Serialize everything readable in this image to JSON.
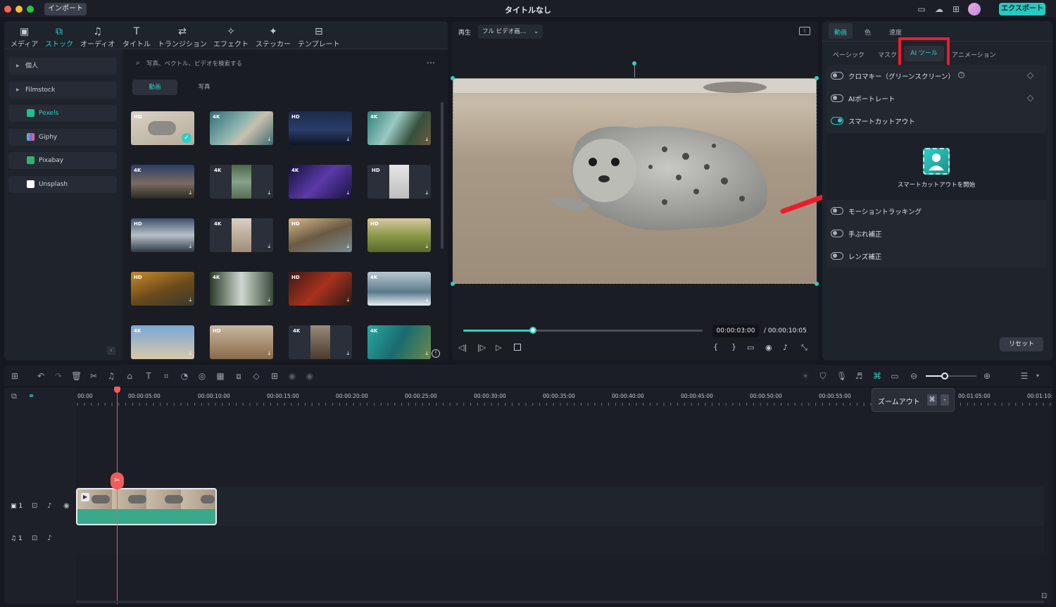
{
  "titlebar": {
    "import_label": "インポート",
    "window_title": "タイトルなし",
    "export_label": "エクスポート"
  },
  "media_toolbar": [
    {
      "label": "メディア",
      "icon": "media-icon"
    },
    {
      "label": "ストック",
      "icon": "stock-icon",
      "active": true
    },
    {
      "label": "オーディオ",
      "icon": "audio-icon"
    },
    {
      "label": "タイトル",
      "icon": "title-icon"
    },
    {
      "label": "トランジション",
      "icon": "transition-icon"
    },
    {
      "label": "エフェクト",
      "icon": "effect-icon"
    },
    {
      "label": "ステッカー",
      "icon": "sticker-icon"
    },
    {
      "label": "テンプレート",
      "icon": "template-icon"
    }
  ],
  "sidebar": {
    "items": [
      {
        "label": "個人"
      },
      {
        "label": "Filmstock"
      },
      {
        "label": "Pexels",
        "color": "#1fbf8f",
        "active": true
      },
      {
        "label": "Giphy",
        "color": "#8a5cf6"
      },
      {
        "label": "Pixabay",
        "color": "#2bb673"
      },
      {
        "label": "Unsplash",
        "color": "#ffffff"
      }
    ]
  },
  "stock": {
    "search_placeholder": "写真、ベクトル、ビデオを検索する",
    "tab_video": "動画",
    "tab_photo": "写真",
    "badges": [
      "HD",
      "4K",
      "HD",
      "4K",
      "4K",
      "4K",
      "4K",
      "HD",
      "HD",
      "4K",
      "HD",
      "HD",
      "HD",
      "4K",
      "HD",
      "4K",
      "4K",
      "HD",
      "4K",
      "4K"
    ]
  },
  "preview": {
    "play_label": "再生",
    "quality": "フル ビデオ画…",
    "current_time": "00:00:03:00",
    "total_time": "/ 00:00:10:05",
    "progress": 0.29
  },
  "properties": {
    "tabs": [
      "動画",
      "色",
      "速度"
    ],
    "subtabs": [
      "ベーシック",
      "マスク",
      "AI ツール",
      "アニメーション"
    ],
    "toggles": [
      {
        "label": "クロマキー（グリーンスクリーン）",
        "on": false
      },
      {
        "label": "AIポートレート",
        "on": false
      },
      {
        "label": "スマートカットアウト",
        "on": true
      }
    ],
    "cutout_button": "スマートカットアウトを開始",
    "toggles2": [
      {
        "label": "モーショントラッキング",
        "on": false
      },
      {
        "label": "手ぶれ補正",
        "on": false
      },
      {
        "label": "レンズ補正",
        "on": false
      }
    ],
    "reset_label": "リセット",
    "highlight_color": "#ee1c2a",
    "accent_color": "#2bd0c6"
  },
  "timeline": {
    "ticks": [
      "00:00",
      "00:00:05:00",
      "00:00:10:00",
      "00:00:15:00",
      "00:00:20:00",
      "00:00:25:00",
      "00:00:30:00",
      "00:00:35:00",
      "00:00:40:00",
      "00:00:45:00",
      "00:00:50:00",
      "00:00:55:00",
      "00:01:05:00",
      "00:01:10:"
    ],
    "tooltip_label": "ズームアウト",
    "tooltip_key1": "⌘",
    "tooltip_key2": "-",
    "video_track": "1",
    "audio_track": "1"
  }
}
